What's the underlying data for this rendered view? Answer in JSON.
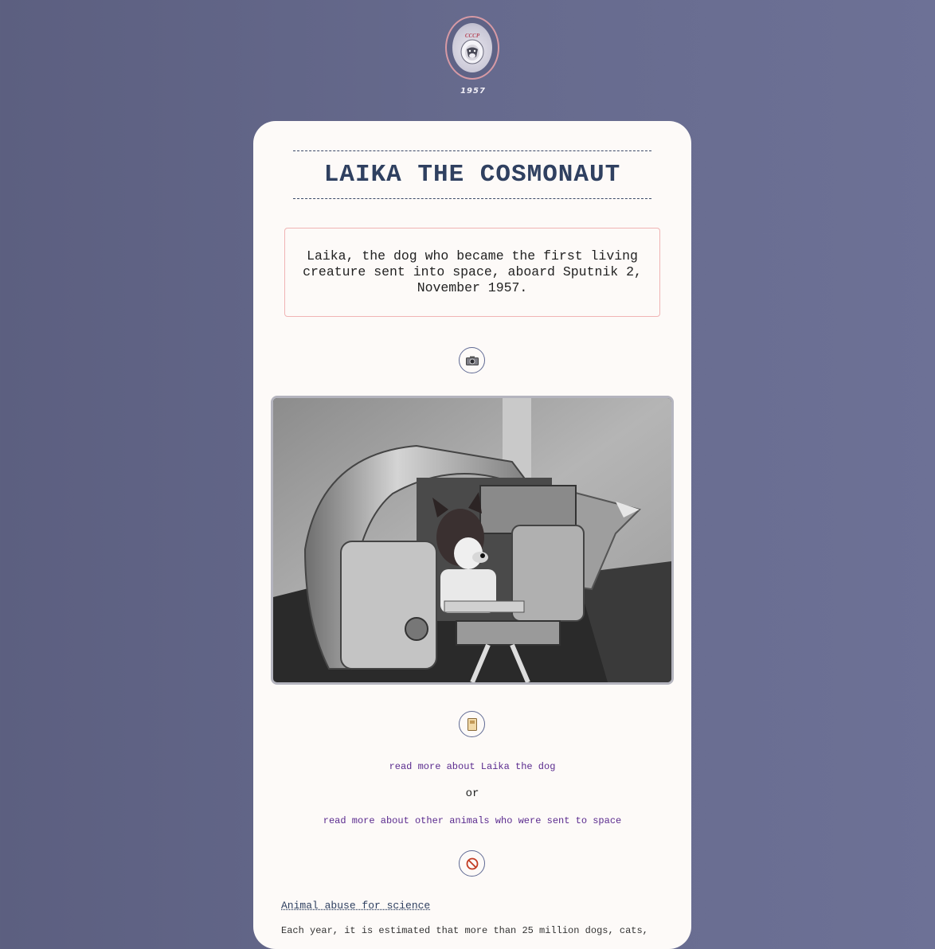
{
  "header": {
    "badge_text": "CCCP",
    "year": "1957"
  },
  "page": {
    "title": "LAIKA THE COSMONAUT",
    "intro": "Laika, the dog who became the first living creature sent into space, aboard Sputnik 2, November 1957."
  },
  "icons": {
    "photo": "camera-icon",
    "reading": "book-icon",
    "prohibited": "no-entry-icon"
  },
  "links": {
    "laika": "read more about Laika the dog",
    "or": "or",
    "animals": "read more about other animals who were sent to space"
  },
  "section": {
    "heading": "Animal abuse for science",
    "body": "Each year, it is estimated that more than 25 million dogs, cats,"
  },
  "colors": {
    "background": "#666a8d",
    "card": "#fdfaf8",
    "title": "#2f4060",
    "link": "#5a2a8e",
    "intro_border": "#f0b4b4"
  }
}
